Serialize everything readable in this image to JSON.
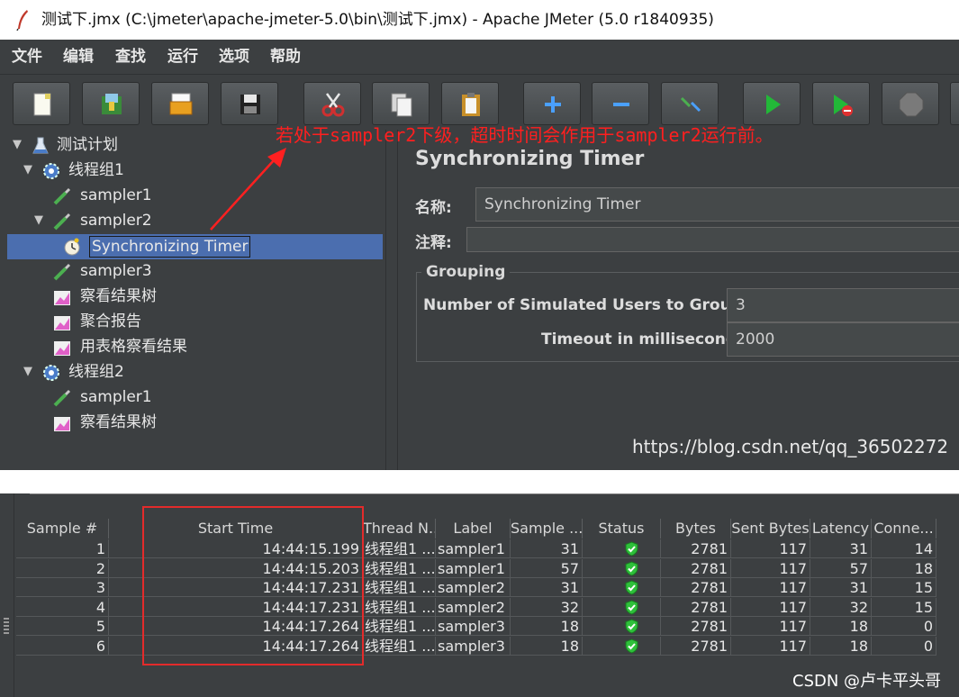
{
  "window": {
    "title": "测试下.jmx (C:\\jmeter\\apache-jmeter-5.0\\bin\\测试下.jmx) - Apache JMeter (5.0 r1840935)"
  },
  "menu": [
    "文件",
    "编辑",
    "查找",
    "运行",
    "选项",
    "帮助"
  ],
  "toolbar": {
    "icons": [
      "new-icon",
      "templates-icon",
      "open-icon",
      "save-icon",
      "cut-icon",
      "copy-icon",
      "paste-icon",
      "expand-icon",
      "collapse-icon",
      "toggle-icon",
      "start-icon",
      "start-no-pauses-icon",
      "stop-icon"
    ]
  },
  "tree": {
    "items": [
      {
        "label": "测试计划"
      },
      {
        "label": "线程组1"
      },
      {
        "label": "sampler1"
      },
      {
        "label": "sampler2"
      },
      {
        "label": "Synchronizing Timer"
      },
      {
        "label": "sampler3"
      },
      {
        "label": "察看结果树"
      },
      {
        "label": "聚合报告"
      },
      {
        "label": "用表格察看结果"
      },
      {
        "label": "线程组2"
      },
      {
        "label": "sampler1"
      },
      {
        "label": "察看结果树"
      }
    ]
  },
  "annotation": {
    "text": "若处于sampler2下级，超时时间会作用于sampler2运行前。",
    "color": "#ff1f1f"
  },
  "panel": {
    "title": "Synchronizing Timer",
    "name_label": "名称:",
    "name_value": "Synchronizing Timer",
    "comment_label": "注释:",
    "comment_value": "",
    "group_title": "Grouping",
    "users_label": "Number of Simulated Users to Group by:",
    "users_value": "3",
    "timeout_label": "Timeout in milliseconds:",
    "timeout_value": "2000"
  },
  "watermark_url": "https://blog.csdn.net/qq_36502272",
  "results": {
    "columns": [
      "Sample #",
      "Start Time",
      "Thread N...",
      "Label",
      "Sample ...",
      "Status",
      "Bytes",
      "Sent Bytes",
      "Latency",
      "Conne..."
    ],
    "rows": [
      [
        "1",
        "14:44:15.199",
        "线程组1 ...",
        "sampler1",
        "31",
        "ok",
        "2781",
        "117",
        "31",
        "14"
      ],
      [
        "2",
        "14:44:15.203",
        "线程组1 ...",
        "sampler1",
        "57",
        "ok",
        "2781",
        "117",
        "57",
        "18"
      ],
      [
        "3",
        "14:44:17.231",
        "线程组1 ...",
        "sampler2",
        "31",
        "ok",
        "2781",
        "117",
        "31",
        "15"
      ],
      [
        "4",
        "14:44:17.231",
        "线程组1 ...",
        "sampler2",
        "32",
        "ok",
        "2781",
        "117",
        "32",
        "15"
      ],
      [
        "5",
        "14:44:17.264",
        "线程组1 ...",
        "sampler3",
        "18",
        "ok",
        "2781",
        "117",
        "18",
        "0"
      ],
      [
        "6",
        "14:44:17.264",
        "线程组1 ...",
        "sampler3",
        "18",
        "ok",
        "2781",
        "117",
        "18",
        "0"
      ]
    ]
  },
  "csdn_mark": "CSDN @卢卡平头哥",
  "colors": {
    "window_bg": "#3c3f41",
    "selection": "#4b6eaf",
    "highlight_box": "#e32b2b",
    "status_ok": "#2ec03a"
  }
}
